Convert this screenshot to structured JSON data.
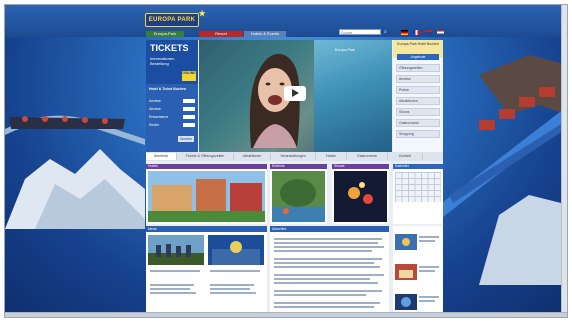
{
  "header": {
    "logo_text": "EUROPA  PARK",
    "nav_items": [
      "Europa-Park",
      "Resort",
      "Hotels & Events"
    ],
    "search_placeholder": "Suche"
  },
  "tickets": {
    "title": "TICKETS",
    "subtitle": "Informationen Bestellung",
    "badge": "ONLINE"
  },
  "booking": {
    "title": "Hotel & Ticket Buchen",
    "rows": [
      "Anreise",
      "Abreise",
      "Erwachsene",
      "Kinder"
    ],
    "button": "Suchen"
  },
  "video": {
    "caption": "Europa-Park"
  },
  "rightcol": {
    "head": "Europa-Park Hotel Buchen",
    "blue_btn": "Angebote",
    "items": [
      "Öffnungszeiten",
      "Anreise",
      "Preise",
      "Attraktionen",
      "Shows",
      "Gastronomie",
      "Shopping"
    ]
  },
  "tabs": [
    "Überblick",
    "Tickets & Öffnungszeiten",
    "Attraktionen",
    "Veranstaltungen",
    "Hotels",
    "Gastronomie",
    "Kontakt"
  ],
  "promos": [
    {
      "title": "Hotels"
    },
    {
      "title": "Erlebnis"
    },
    {
      "title": "Shows"
    }
  ],
  "calendar": {
    "title": "Kalender"
  },
  "news": [
    {
      "title": "News"
    },
    {
      "title": "Aktuelles"
    }
  ],
  "colors": {
    "brand_blue": "#1b4ea0",
    "accent_yellow": "#f4d52c",
    "purple": "#6b3fa0"
  }
}
